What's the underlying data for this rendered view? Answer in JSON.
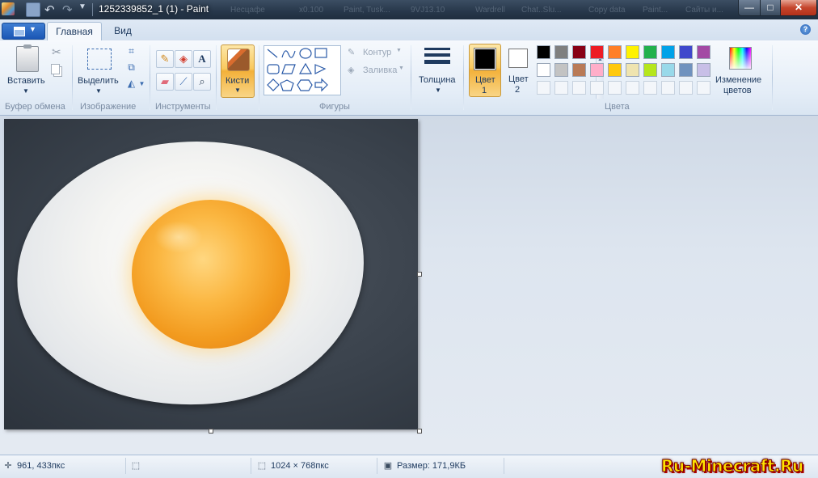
{
  "window": {
    "title": "1252339852_1 (1) - Paint",
    "background_tabs": [
      "Несцафе",
      "x0.100",
      "Paint, Tusk...",
      "9VJ13.10",
      "Wardrell",
      "Chat..Slu...",
      "Copy data",
      "Paint...",
      "Сайты и..."
    ],
    "controls": {
      "minimize": "—",
      "maximize": "□",
      "close": "✕"
    }
  },
  "tabs": {
    "home": "Главная",
    "view": "Вид"
  },
  "ribbon": {
    "clipboard": {
      "paste": "Вставить",
      "group": "Буфер обмена"
    },
    "image": {
      "select": "Выделить",
      "group": "Изображение"
    },
    "tools": {
      "group": "Инструменты",
      "text_tool": "A"
    },
    "brushes": {
      "label": "Кисти"
    },
    "shapes": {
      "outline": "Контур",
      "fill": "Заливка",
      "group": "Фигуры"
    },
    "size": {
      "label": "Толщина"
    },
    "colors": {
      "color1_line1": "Цвет",
      "color1_line2": "1",
      "color2_line1": "Цвет",
      "color2_line2": "2",
      "edit_line1": "Изменение",
      "edit_line2": "цветов",
      "group": "Цвета",
      "color1": "#000000",
      "color2": "#ffffff",
      "palette_row1": [
        "#000000",
        "#7f7f7f",
        "#880015",
        "#ed1c24",
        "#ff7f27",
        "#fff200",
        "#22b14c",
        "#00a2e8",
        "#3f48cc",
        "#a349a4"
      ],
      "palette_row2": [
        "#ffffff",
        "#c3c3c3",
        "#b97a57",
        "#ffaec9",
        "#ffc90e",
        "#efe4b0",
        "#b5e61d",
        "#99d9ea",
        "#7092be",
        "#c8bfe7"
      ]
    }
  },
  "status": {
    "cursor_pos": "961, 433пкс",
    "image_size": "1024 × 768пкс",
    "file_size": "Размер: 171,9КБ"
  },
  "watermark": "Ru-Minecraft.Ru"
}
